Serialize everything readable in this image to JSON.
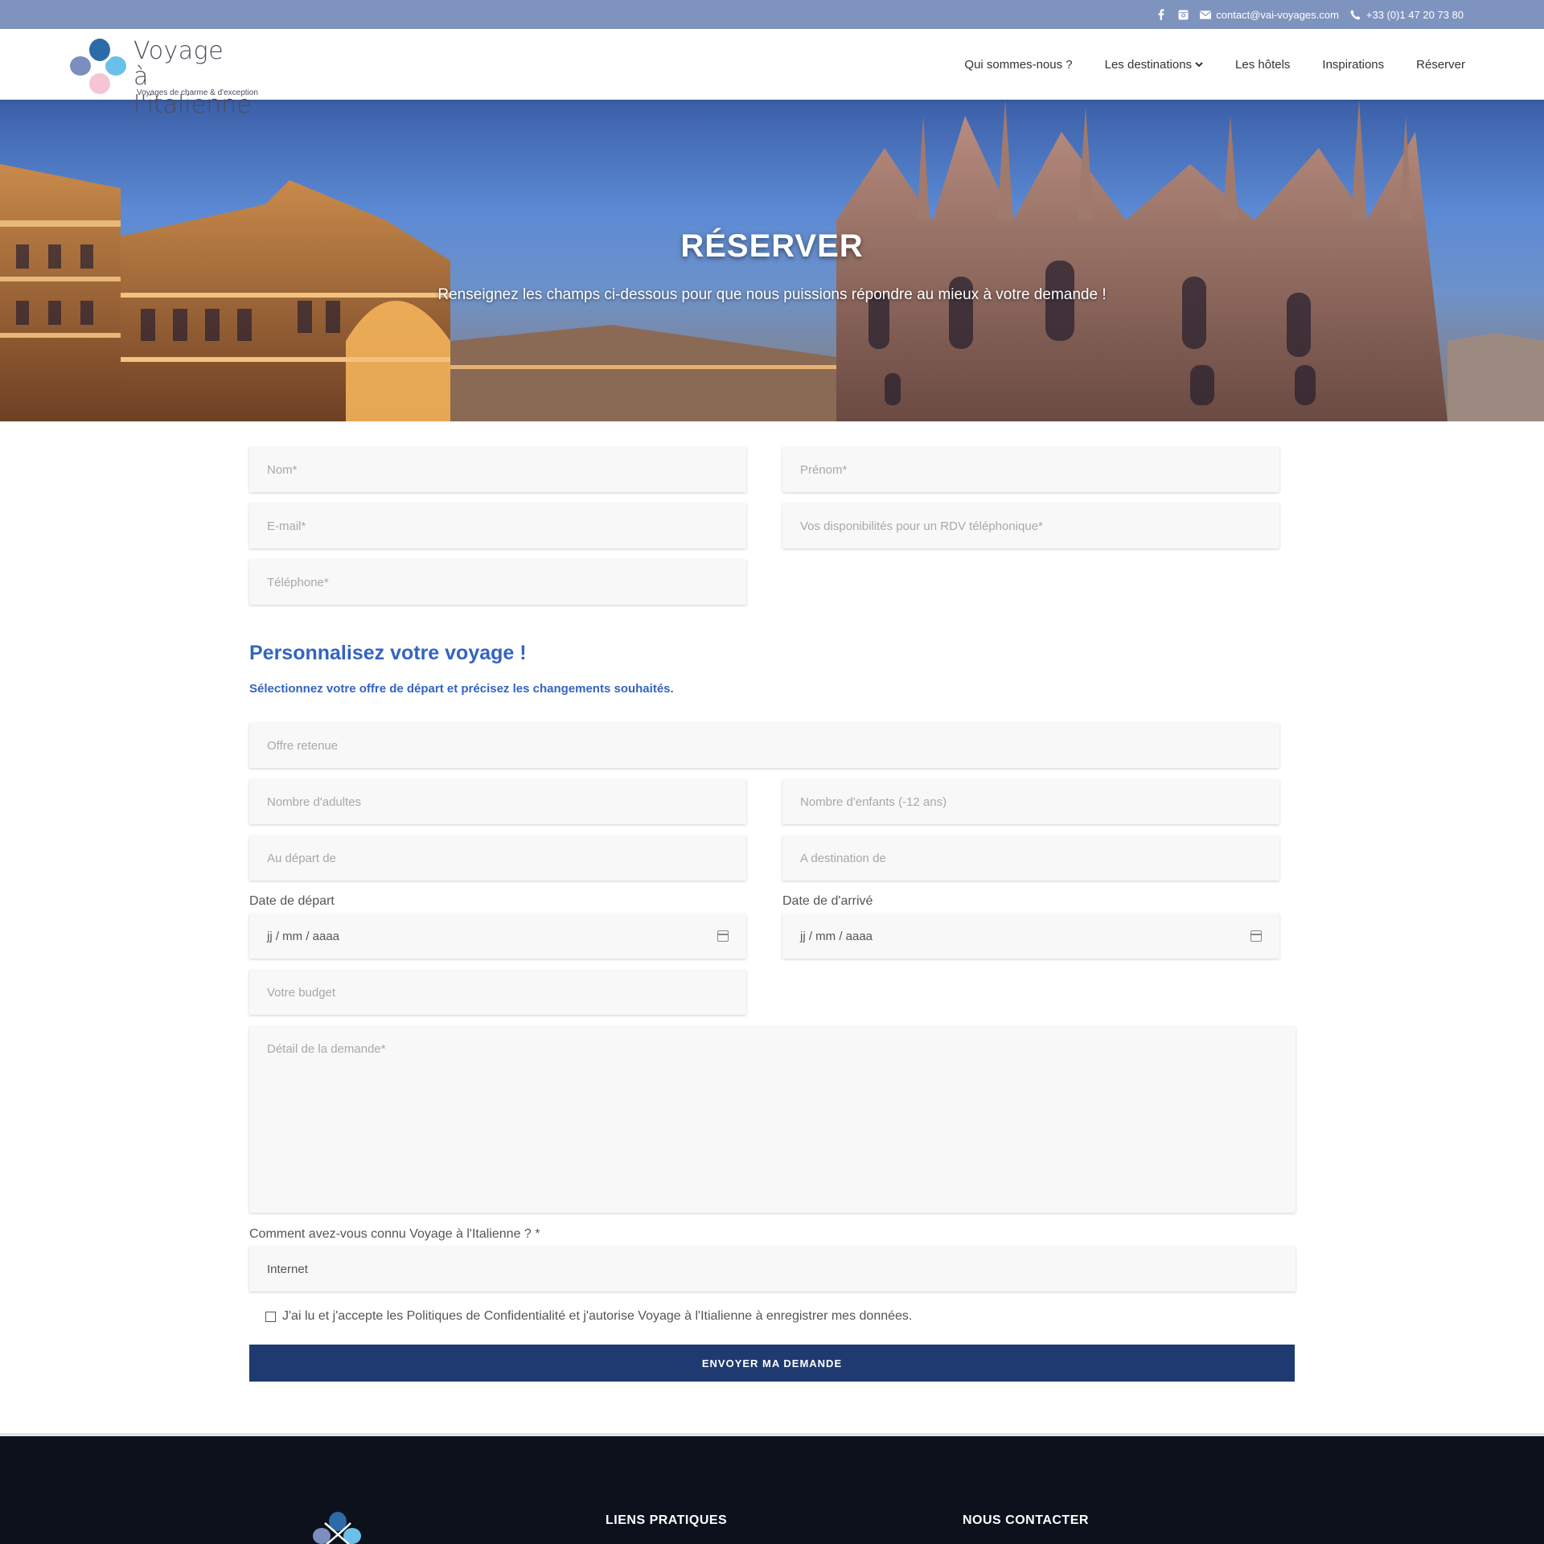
{
  "topbar": {
    "email": "contact@vai-voyages.com",
    "phone": "+33 (0)1 47 20 73 80",
    "icons": [
      "facebook-icon",
      "instagram-icon",
      "envelope-icon",
      "phone-icon"
    ]
  },
  "header": {
    "logo_line1": "Voyage",
    "logo_line2": "à l'italienne",
    "logo_tagline": "Voyages de charme & d'exception",
    "nav": [
      "Qui sommes-nous ?",
      "Les destinations",
      "Les hôtels",
      "Inspirations",
      "Réserver"
    ]
  },
  "hero": {
    "title": "RÉSERVER",
    "subtitle": "Renseignez les champs ci-dessous pour que nous puissions répondre au mieux à votre demande !"
  },
  "form": {
    "nom_placeholder": "Nom*",
    "prenom_placeholder": "Prénom*",
    "email_placeholder": "E-mail*",
    "dispo_placeholder": "Vos disponibilités pour un RDV téléphonique*",
    "telephone_placeholder": "Téléphone*",
    "section_title": "Personnalisez votre voyage !",
    "section_sub": "Sélectionnez votre offre de départ et précisez les changements souhaités.",
    "offre_placeholder": "Offre retenue",
    "adultes_placeholder": "Nombre d'adultes",
    "enfants_placeholder": "Nombre d'enfants (-12 ans)",
    "depart_placeholder": "Au départ de",
    "destination_placeholder": "A destination de",
    "date_depart_label": "Date de départ",
    "date_arrive_label": "Date de d'arrivé",
    "date_format": "jj / mm / aaaa",
    "budget_placeholder": "Votre budget",
    "detail_placeholder": "Détail de la demande*",
    "source_label": "Comment avez-vous connu Voyage à l'Italienne ? *",
    "source_value": "Internet",
    "consent_text": "J'ai lu et j'accepte les Politiques de Confidentialité et j'autorise Voyage à l'Itialienne à enregistrer mes données.",
    "submit_label": "ENVOYER MA DEMANDE"
  },
  "footer": {
    "col1_title": "LIENS PRATIQUES",
    "col2_title": "NOUS CONTACTER"
  },
  "colors": {
    "topbar": "#7f93bf",
    "accent": "#3464c0",
    "button": "#1e3a70",
    "footer": "#0c111c"
  }
}
